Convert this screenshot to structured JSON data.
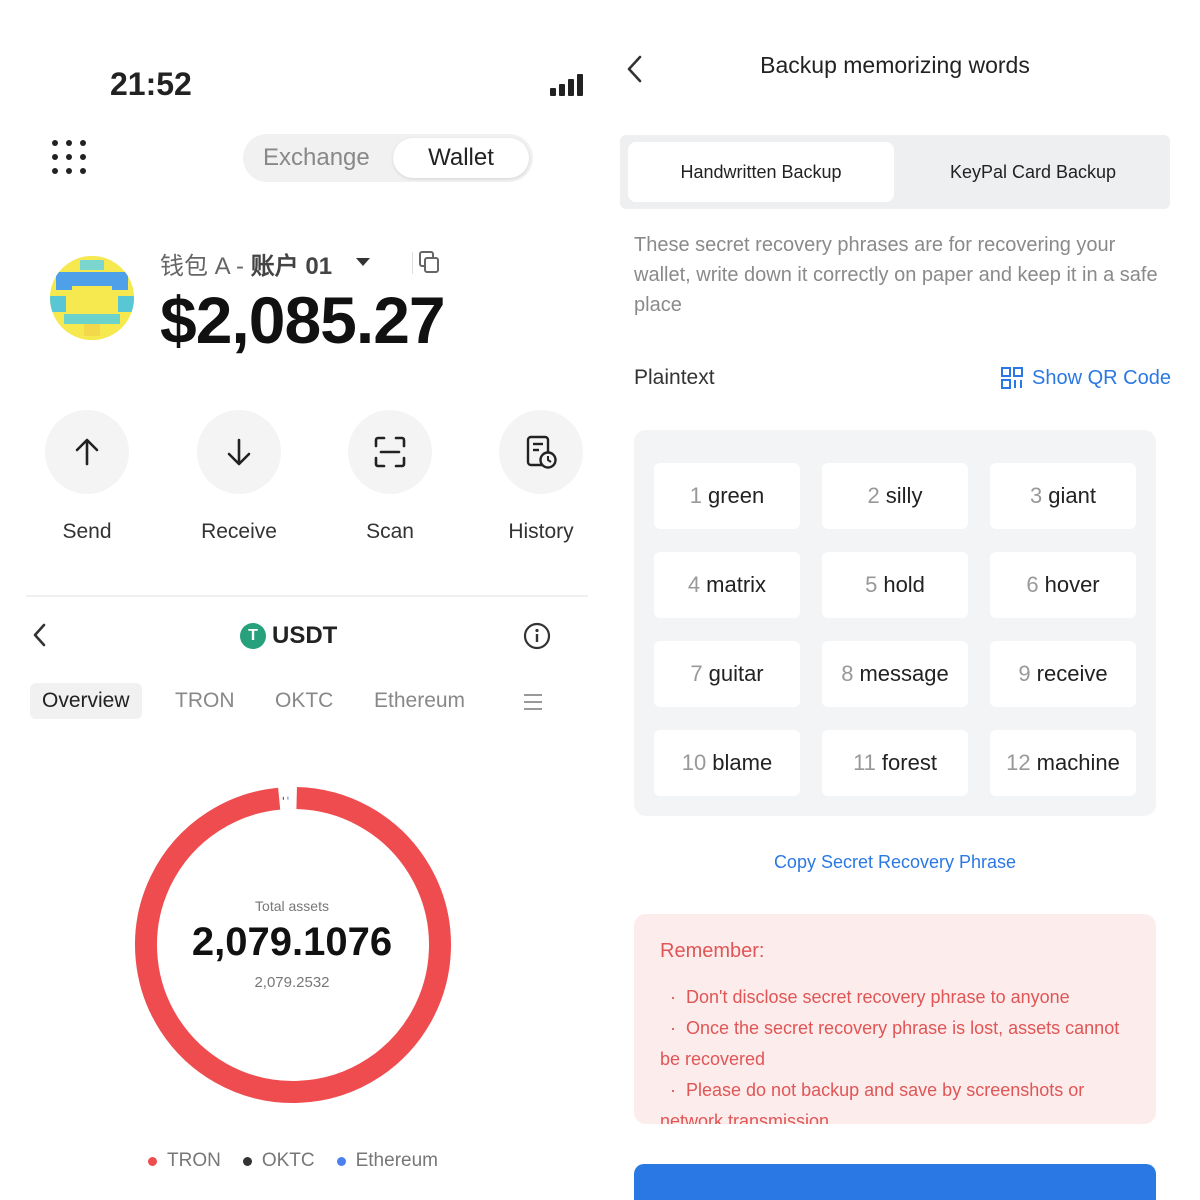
{
  "status_bar": {
    "time": "21:52"
  },
  "wallet": {
    "segment": {
      "exchange": "Exchange",
      "wallet": "Wallet"
    },
    "account_name_prefix": "钱包 A - ",
    "account_name": "账户 01",
    "balance": "$2,085.27",
    "actions": [
      {
        "label": "Send",
        "icon": "arrow-up-icon"
      },
      {
        "label": "Receive",
        "icon": "arrow-down-icon"
      },
      {
        "label": "Scan",
        "icon": "scan-icon"
      },
      {
        "label": "History",
        "icon": "history-icon"
      }
    ]
  },
  "token": {
    "name": "USDT",
    "logo_letter": "T",
    "tabs": [
      "Overview",
      "TRON",
      "OKTC",
      "Ethereum"
    ],
    "active_tab": "Overview",
    "total_label": "Total assets",
    "total_value": "2,079.1076",
    "total_secondary": "2,079.2532",
    "chart_data": {
      "type": "pie",
      "series": [
        {
          "name": "TRON",
          "color": "#ef4c4f",
          "share": 0.985
        },
        {
          "name": "OKTC",
          "color": "#333333",
          "share": 0.005
        },
        {
          "name": "Ethereum",
          "color": "#4a7ff0",
          "share": 0.005
        }
      ],
      "legend": [
        "TRON",
        "OKTC",
        "Ethereum"
      ]
    }
  },
  "backup": {
    "title": "Backup memorizing words",
    "tabs": {
      "handwritten": "Handwritten Backup",
      "keypal": "KeyPal Card Backup"
    },
    "description": "These secret recovery phrases are for recovering your wallet, write down it correctly on paper and keep it in a safe place",
    "plaintext_label": "Plaintext",
    "show_qr": "Show QR Code",
    "words": [
      {
        "n": "1",
        "w": "green"
      },
      {
        "n": "2",
        "w": "silly"
      },
      {
        "n": "3",
        "w": "giant"
      },
      {
        "n": "4",
        "w": "matrix"
      },
      {
        "n": "5",
        "w": "hold"
      },
      {
        "n": "6",
        "w": "hover"
      },
      {
        "n": "7",
        "w": "guitar"
      },
      {
        "n": "8",
        "w": "message"
      },
      {
        "n": "9",
        "w": "receive"
      },
      {
        "n": "10",
        "w": "blame"
      },
      {
        "n": "11",
        "w": "forest"
      },
      {
        "n": "12",
        "w": "machine"
      }
    ],
    "copy_phrase": "Copy Secret Recovery Phrase",
    "remember_title": "Remember:",
    "remember_items": [
      "Don't disclose secret recovery phrase to anyone",
      "Once the secret recovery phrase is lost, assets cannot be recovered",
      "Please do not backup and save by screenshots or network transmission"
    ],
    "accent": "#2a78e4",
    "warning_color": "#e05555"
  }
}
